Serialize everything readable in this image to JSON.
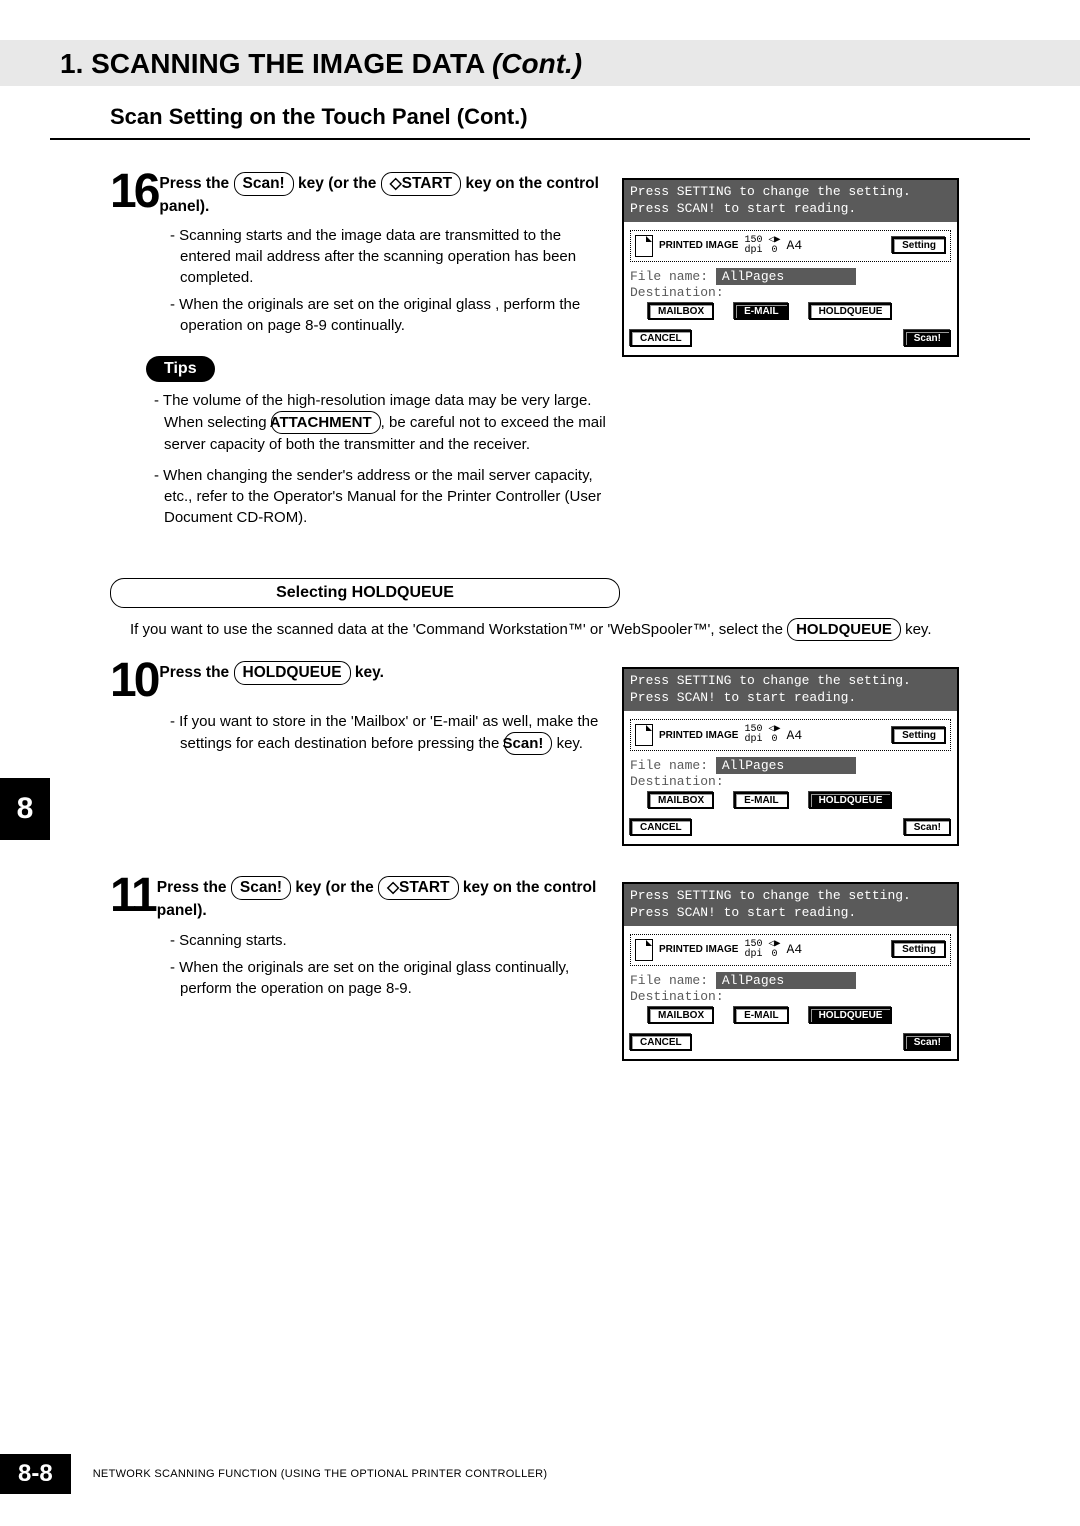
{
  "chapter_title_prefix": "1. SCANNING THE IMAGE DATA",
  "chapter_title_suffix": "(Cont.)",
  "section_title": "Scan Setting on the Touch Panel (Cont.)",
  "step16": {
    "num": "16",
    "text_before": "Press the ",
    "btn1": "Scan!",
    "text_mid": " key (or the ",
    "btn2": "◇START",
    "text_after": " key on the control panel).",
    "bullets": [
      "Scanning starts and the image data are transmitted to the entered mail address after the scanning operation has been completed.",
      "When the originals are set on the original glass , perform the operation on page 8-9 continually."
    ]
  },
  "tips_label": "Tips",
  "tips": {
    "b1_pre": "The volume of the high-resolution image data may be very large. When selecting ",
    "b1_btn": "ATTACHMENT",
    "b1_post": ", be careful not to exceed the mail server capacity of both the transmitter and the receiver.",
    "b2": "When changing the sender's address or the mail server capacity, etc., refer to the Operator's Manual for the Printer Controller (User Document CD-ROM)."
  },
  "subsection_title": "Selecting HOLDQUEUE",
  "holdqueue_intro_pre": "If you want to use the scanned data at the 'Command Workstation™' or 'WebSpooler™', select the ",
  "holdqueue_intro_btn": "HOLDQUEUE",
  "holdqueue_intro_post": " key.",
  "step10": {
    "num": "10",
    "text_before": "Press the ",
    "btn": "HOLDQUEUE",
    "text_after": " key.",
    "bullet_pre": "If you want to store in the 'Mailbox' or 'E-mail' as well, make the settings for each destination before pressing the ",
    "bullet_btn": "Scan!",
    "bullet_post": " key."
  },
  "step11": {
    "num": "11",
    "text_before": "Press the ",
    "btn1": "Scan!",
    "text_mid": " key (or the ",
    "btn2": "◇START",
    "text_after": " key on the control panel).",
    "bullets": [
      "Scanning starts.",
      "When the originals are set on the original glass continually, perform the operation on page 8-9."
    ]
  },
  "screen": {
    "line1": "Press SETTING to change the setting.",
    "line2": "Press SCAN! to start reading.",
    "printed": "PRINTED IMAGE",
    "dpi_top": "150",
    "dpi_bot": "dpi",
    "arrows_top": "◁▶",
    "arrows_bot": "0",
    "paper": "A4",
    "setting": "Setting",
    "filename_label": "File name:",
    "filename_value": "AllPages",
    "dest_label": "Destination:",
    "mailbox": "MAILBOX",
    "email": "E-MAIL",
    "holdqueue": "HOLDQUEUE",
    "cancel": "CANCEL",
    "scan": "Scan!"
  },
  "side_tab": "8",
  "page_number": "8-8",
  "footer_text": "NETWORK SCANNING FUNCTION (USING THE OPTIONAL PRINTER CONTROLLER)"
}
